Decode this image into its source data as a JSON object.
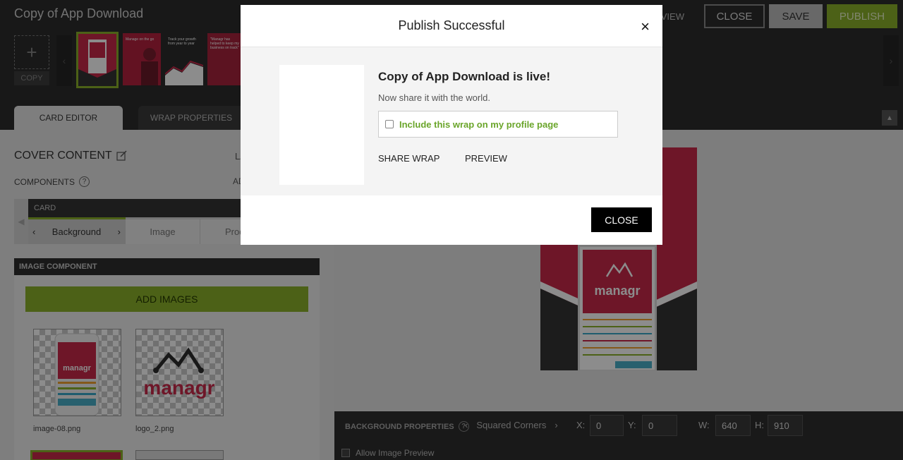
{
  "app": {
    "title": "Copy of App Download",
    "preview_label": "REVIEW",
    "close_label": "CLOSE",
    "save_label": "SAVE",
    "publish_label": "PUBLISH"
  },
  "card_strip": {
    "add_icon": "+",
    "copy_label": "COPY",
    "left_arrow": "‹",
    "right_arrow": "›",
    "thumbs": [
      {
        "text": ""
      },
      {
        "text": "Manage on the go"
      },
      {
        "text": "Track your growth from year to year"
      },
      {
        "text": "\"Managr has helped to keep my business on track\""
      }
    ]
  },
  "tabs": {
    "card_editor": "CARD EDITOR",
    "wrap_properties": "WRAP PROPERTIES"
  },
  "left": {
    "cover_title": "COVER CONTENT",
    "la_label": "LA",
    "components_label": "COMPONENTS",
    "ad_label": "AD",
    "card_label": "CARD",
    "component_tabs": [
      "Background",
      "Image",
      "Prod"
    ],
    "image_component_label": "IMAGE COMPONENT",
    "add_images_label": "ADD IMAGES",
    "images": [
      {
        "name": "image-08.png"
      },
      {
        "name": "logo_2.png"
      }
    ],
    "logo_word": "managr"
  },
  "bottom": {
    "bg_props_label": "BACKGROUND PROPERTIES",
    "corners_label": "Squared Corners",
    "x_label": "X:",
    "x_value": "0",
    "y_label": "Y:",
    "y_value": "0",
    "w_label": "W:",
    "w_value": "640",
    "h_label": "H:",
    "h_value": "910",
    "allow_preview_label": "Allow Image Preview"
  },
  "modal": {
    "title": "Publish Successful",
    "close_x": "×",
    "live_title": "Copy of App Download is live!",
    "live_sub": "Now share it with the world.",
    "include_label": "Include this wrap on my profile page",
    "share_label": "SHARE WRAP",
    "preview_label": "PREVIEW",
    "close_label": "CLOSE"
  },
  "colors": {
    "accent_green": "#8ab12a",
    "brand_red": "#c8284a",
    "dark": "#2d2d2d"
  }
}
